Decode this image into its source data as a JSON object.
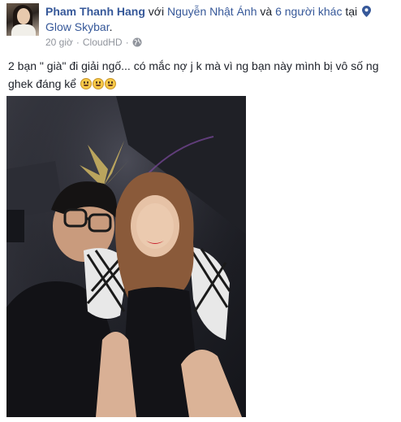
{
  "post": {
    "author": "Pham Thanh Hang",
    "with_word": "với",
    "tagged_person": "Nguyễn Nhật Ánh",
    "and_word": "và",
    "others": "6 người khác",
    "at_word": "tại",
    "place": "Glow Skybar",
    "time": "20 giờ",
    "source": "CloudHD",
    "text": "2 bạn \" già\" đi giải ngố... có mắc nợ j k mà vì ng bạn này mình bị vô số ng ghek đáng kể"
  },
  "icons": {
    "location": "location-pin-icon",
    "privacy": "globe-icon",
    "emoji": "crying-laughing-emoji-icon"
  },
  "colors": {
    "link": "#365899",
    "meta": "#90949c",
    "text": "#1d2129"
  }
}
